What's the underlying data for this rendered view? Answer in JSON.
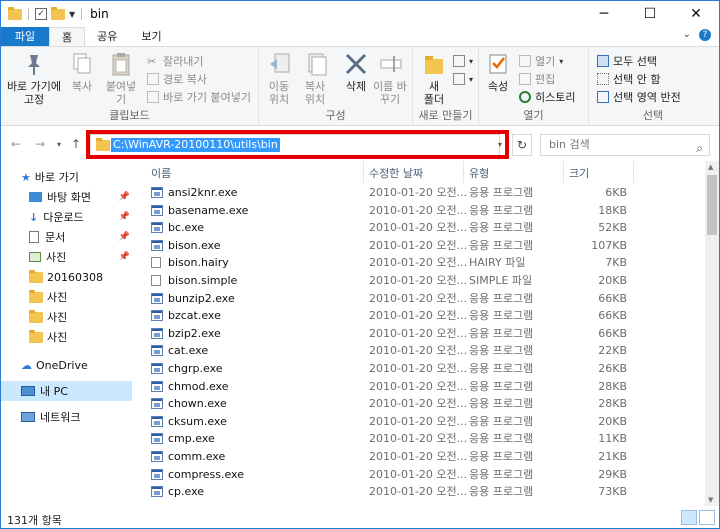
{
  "window": {
    "title": "bin",
    "buttons": {
      "minimize": "─",
      "maximize": "☐",
      "close": "✕"
    }
  },
  "tabs": [
    "파일",
    "홈",
    "공유",
    "보기"
  ],
  "ribbon": {
    "clipboard": {
      "label": "클립보드",
      "pin": "바로 가기에 고정",
      "copy": "복사",
      "paste": "붙여넣기",
      "cut": "잘라내기",
      "copy_path": "경로 복사",
      "paste_shortcut": "바로 가기 붙여넣기"
    },
    "organize": {
      "label": "구성",
      "move_to": "이동 위치",
      "copy_to": "복사 위치",
      "delete": "삭제",
      "rename": "이름 바꾸기"
    },
    "new": {
      "label": "새로 만들기",
      "new_folder": "새 폴더"
    },
    "open": {
      "label": "열기",
      "properties": "속성",
      "open": "열기",
      "edit": "편집",
      "history": "히스토리"
    },
    "select": {
      "label": "선택",
      "select_all": "모두 선택",
      "select_none": "선택 안 함",
      "invert": "선택 영역 반전"
    }
  },
  "address": {
    "path": "C:\\WinAVR-20100110\\utils\\bin",
    "search_placeholder": "bin 검색"
  },
  "nav": {
    "quick_access": "바로 가기",
    "items": [
      "바탕 화면",
      "다운로드",
      "문서",
      "사진",
      "20160308",
      "사진",
      "사진",
      "사진"
    ],
    "onedrive": "OneDrive",
    "this_pc": "내 PC",
    "network": "네트워크"
  },
  "columns": {
    "name": "이름",
    "date": "수정한 날짜",
    "type": "유형",
    "size": "크기"
  },
  "files": [
    {
      "name": "ansi2knr.exe",
      "date": "2010-01-20 오전...",
      "type": "응용 프로그램",
      "size": "6KB",
      "icon": "exe"
    },
    {
      "name": "basename.exe",
      "date": "2010-01-20 오전...",
      "type": "응용 프로그램",
      "size": "18KB",
      "icon": "exe"
    },
    {
      "name": "bc.exe",
      "date": "2010-01-20 오전...",
      "type": "응용 프로그램",
      "size": "52KB",
      "icon": "exe"
    },
    {
      "name": "bison.exe",
      "date": "2010-01-20 오전...",
      "type": "응용 프로그램",
      "size": "107KB",
      "icon": "exe"
    },
    {
      "name": "bison.hairy",
      "date": "2010-01-20 오전...",
      "type": "HAIRY 파일",
      "size": "7KB",
      "icon": "doc"
    },
    {
      "name": "bison.simple",
      "date": "2010-01-20 오전...",
      "type": "SIMPLE 파일",
      "size": "20KB",
      "icon": "doc"
    },
    {
      "name": "bunzip2.exe",
      "date": "2010-01-20 오전...",
      "type": "응용 프로그램",
      "size": "66KB",
      "icon": "exe"
    },
    {
      "name": "bzcat.exe",
      "date": "2010-01-20 오전...",
      "type": "응용 프로그램",
      "size": "66KB",
      "icon": "exe"
    },
    {
      "name": "bzip2.exe",
      "date": "2010-01-20 오전...",
      "type": "응용 프로그램",
      "size": "66KB",
      "icon": "exe"
    },
    {
      "name": "cat.exe",
      "date": "2010-01-20 오전...",
      "type": "응용 프로그램",
      "size": "22KB",
      "icon": "exe"
    },
    {
      "name": "chgrp.exe",
      "date": "2010-01-20 오전...",
      "type": "응용 프로그램",
      "size": "26KB",
      "icon": "exe"
    },
    {
      "name": "chmod.exe",
      "date": "2010-01-20 오전...",
      "type": "응용 프로그램",
      "size": "28KB",
      "icon": "exe"
    },
    {
      "name": "chown.exe",
      "date": "2010-01-20 오전...",
      "type": "응용 프로그램",
      "size": "28KB",
      "icon": "exe"
    },
    {
      "name": "cksum.exe",
      "date": "2010-01-20 오전...",
      "type": "응용 프로그램",
      "size": "20KB",
      "icon": "exe"
    },
    {
      "name": "cmp.exe",
      "date": "2010-01-20 오전...",
      "type": "응용 프로그램",
      "size": "11KB",
      "icon": "exe"
    },
    {
      "name": "comm.exe",
      "date": "2010-01-20 오전...",
      "type": "응용 프로그램",
      "size": "21KB",
      "icon": "exe"
    },
    {
      "name": "compress.exe",
      "date": "2010-01-20 오전...",
      "type": "응용 프로그램",
      "size": "29KB",
      "icon": "exe"
    },
    {
      "name": "cp.exe",
      "date": "2010-01-20 오전...",
      "type": "응용 프로그램",
      "size": "73KB",
      "icon": "exe"
    }
  ],
  "status": {
    "count": "131개 항목"
  },
  "colors": {
    "accent": "#1979ca",
    "selection": "#3399ff",
    "highlight_box": "#e50000",
    "nav_selected": "#cce8ff"
  }
}
